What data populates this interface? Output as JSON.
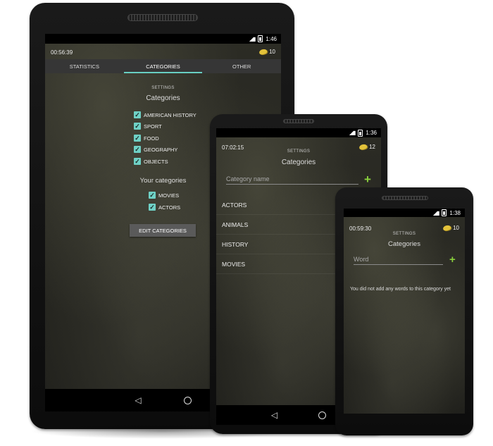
{
  "tablet": {
    "clock": "1:46",
    "timer": "00:56:39",
    "coins": "10",
    "tabs": [
      {
        "label": "STATISTICS",
        "active": false
      },
      {
        "label": "CATEGORIES",
        "active": true
      },
      {
        "label": "OTHER",
        "active": false
      }
    ],
    "settings_label": "SETTINGS",
    "categories_heading": "Categories",
    "categories": [
      "AMERICAN HISTORY",
      "SPORT",
      "FOOD",
      "GEOGRAPHY",
      "OBJECTS"
    ],
    "your_categories_heading": "Your categories",
    "your_categories": [
      "MOVIES",
      "ACTORS"
    ],
    "edit_button": "EDIT CATEGORIES"
  },
  "phone_middle": {
    "clock": "1:36",
    "timer": "07:02:15",
    "coins": "12",
    "settings_label": "SETTINGS",
    "heading": "Categories",
    "input_placeholder": "Category name",
    "list": [
      "ACTORS",
      "ANIMALS",
      "HISTORY",
      "MOVIES"
    ]
  },
  "phone_small": {
    "clock": "1:38",
    "timer": "00:59:30",
    "coins": "10",
    "settings_label": "SETTINGS",
    "heading": "Categories",
    "input_placeholder": "Word",
    "empty_message": "You did not add any words to this category yet"
  },
  "colors": {
    "accent_teal": "#68cfc3",
    "add_green": "#8ad13c",
    "coin_yellow": "#e3c23a"
  },
  "icons": [
    "signal-icon",
    "battery-icon",
    "coin-icon",
    "check-icon",
    "plus-icon",
    "back-icon",
    "home-icon"
  ]
}
